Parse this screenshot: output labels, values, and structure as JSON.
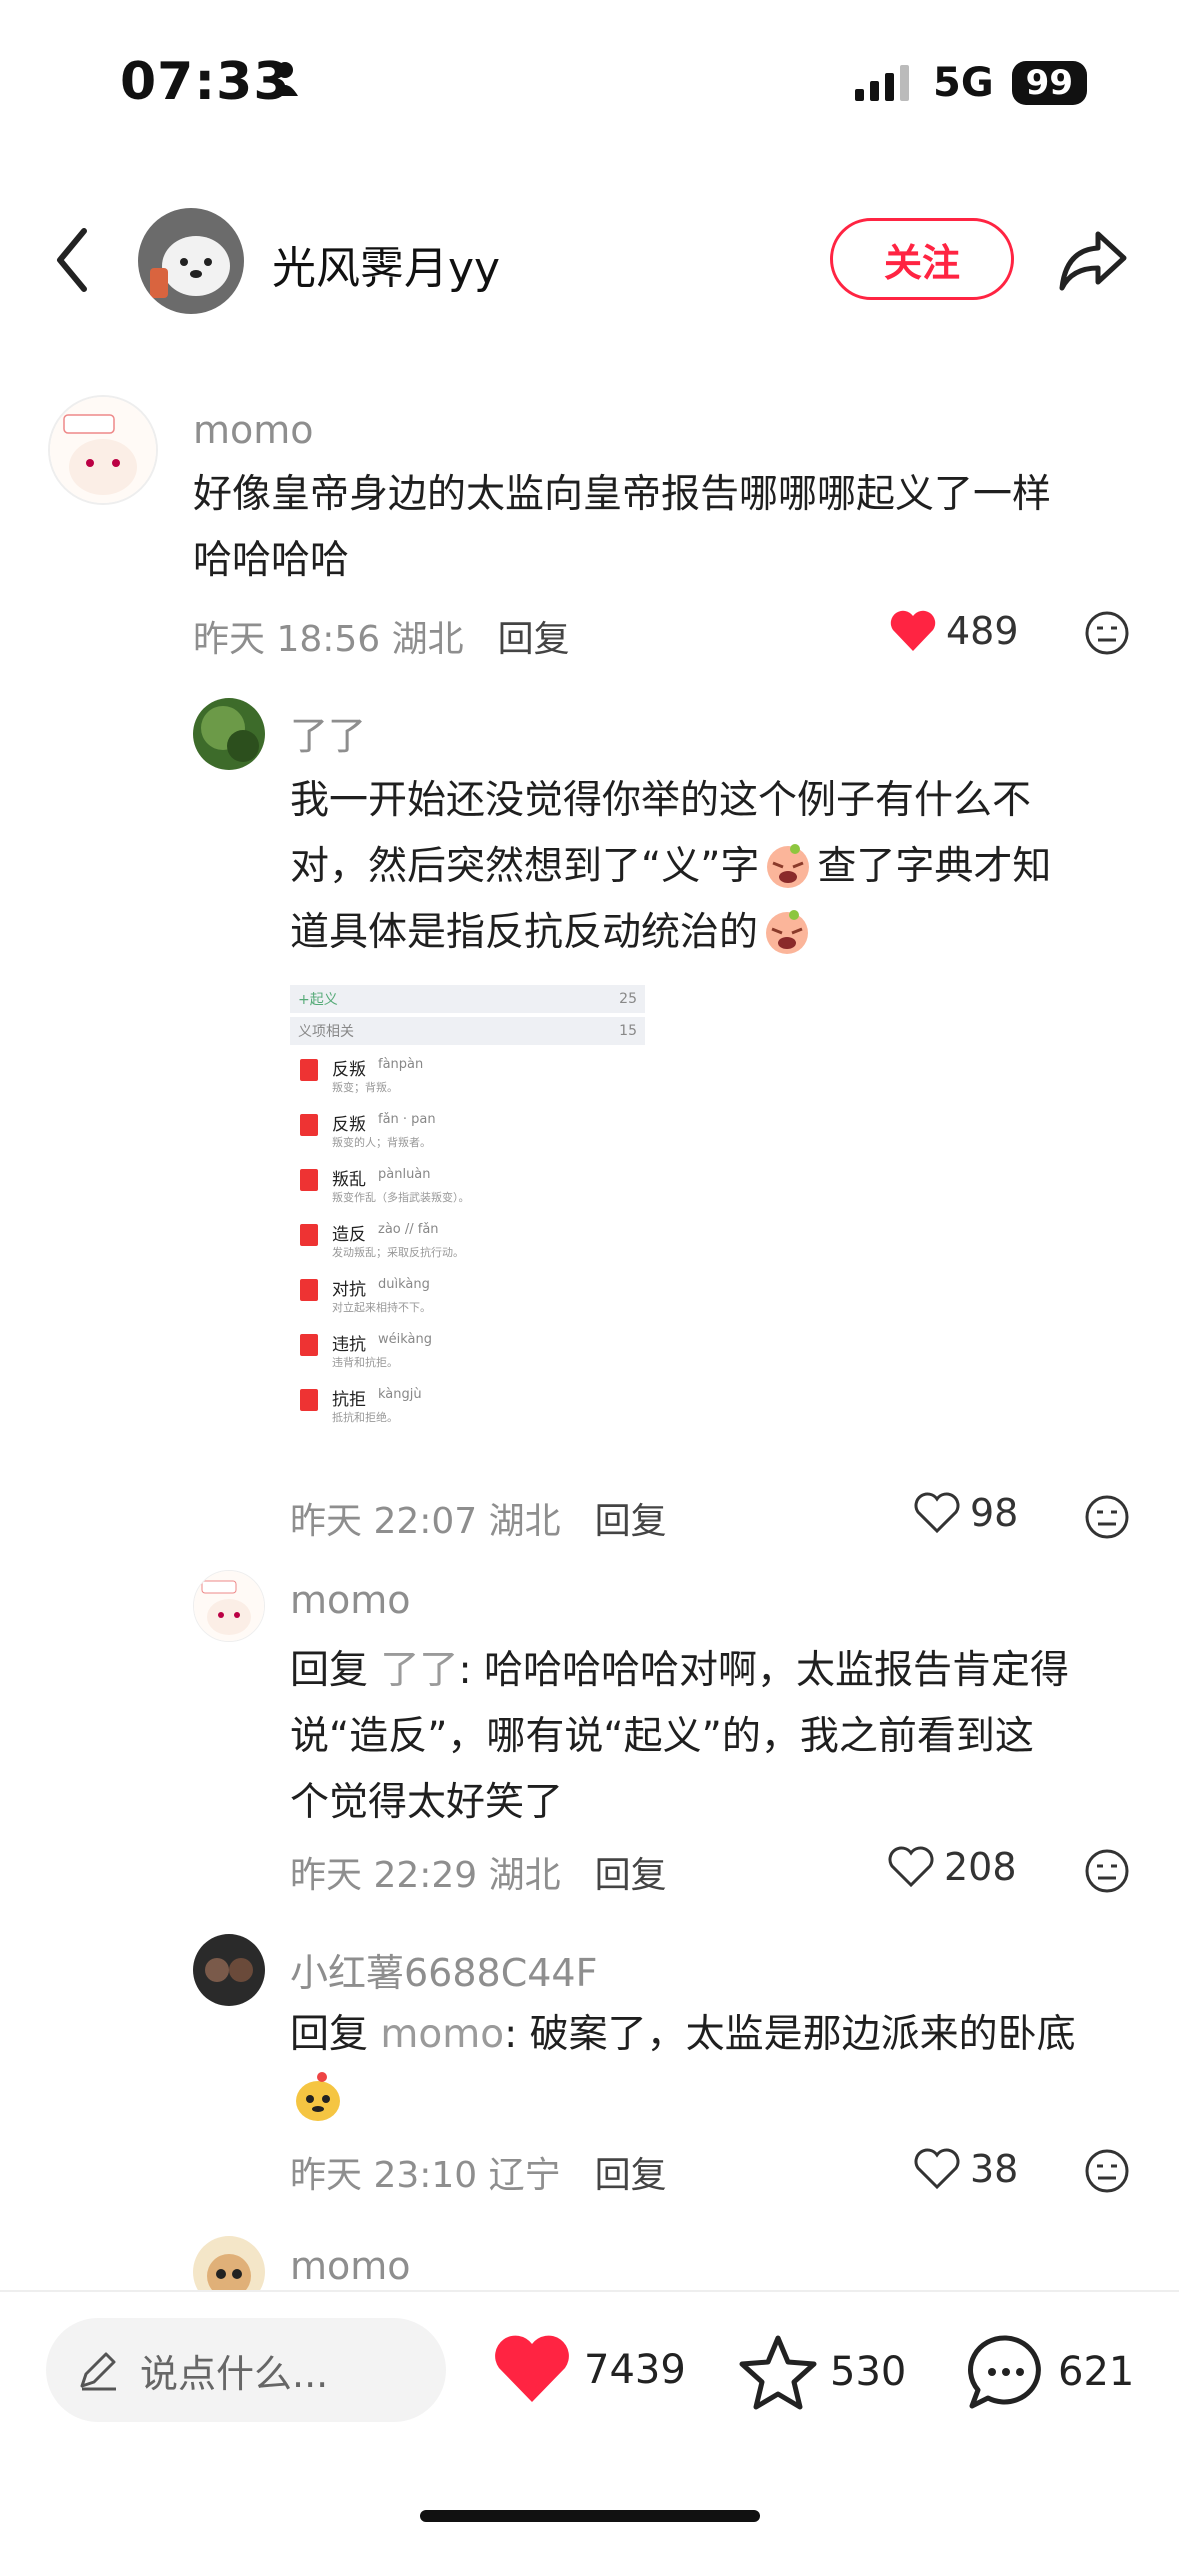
{
  "status_bar": {
    "time": "07:33",
    "network": "5G",
    "battery": "99"
  },
  "header": {
    "author_name": "光风霁月yy",
    "follow_label": "关注"
  },
  "comments": [
    {
      "user": "momo",
      "text": "好像皇帝身边的太监向皇帝报告哪哪哪起义了一样哈哈哈哈",
      "line1": "好像皇帝身边的太监向皇帝报告哪哪哪起义了一样",
      "line2": "哈哈哈哈",
      "time": "昨天 18:56 湖北",
      "reply_label": "回复",
      "likes": "489",
      "liked": true
    },
    {
      "user": "了了",
      "line1": "我一开始还没觉得你举的这个例子有什么不",
      "line2a": "对，然后突然想到了“义”字",
      "line2b": "查了字典才知",
      "line3": "道具体是指反抗反动统治的",
      "time": "昨天 22:07 湖北",
      "reply_label": "回复",
      "likes": "98",
      "liked": false,
      "dict_image": {
        "head_word": "+起义",
        "head_count": "25",
        "section": "义项相关",
        "section_count": "15",
        "entries": [
          {
            "word": "反叛",
            "pinyin": "fànpàn",
            "def": "叛变；背叛。"
          },
          {
            "word": "反叛",
            "pinyin": "fǎn · pan",
            "def": "叛变的人；背叛者。"
          },
          {
            "word": "叛乱",
            "pinyin": "pànluàn",
            "def": "叛变作乱（多指武装叛变）。"
          },
          {
            "word": "造反",
            "pinyin": "zào // fǎn",
            "def": "发动叛乱；采取反抗行动。"
          },
          {
            "word": "对抗",
            "pinyin": "duìkàng",
            "def": "对立起来相持不下。"
          },
          {
            "word": "违抗",
            "pinyin": "wéikàng",
            "def": "违背和抗拒。"
          },
          {
            "word": "抗拒",
            "pinyin": "kàngjù",
            "def": "抵抗和拒绝。"
          }
        ]
      }
    },
    {
      "user": "momo",
      "reply_prefix": "回复",
      "mention": "了了",
      "line1_rest": ": 哈哈哈哈哈对啊，太监报告肯定得",
      "line2": "说“造反”，哪有说“起义”的，我之前看到这",
      "line3": "个觉得太好笑了",
      "time": "昨天 22:29 湖北",
      "reply_label": "回复",
      "likes": "208",
      "liked": false
    },
    {
      "user": "小红薯6688C44F",
      "reply_prefix": "回复",
      "mention": "momo",
      "line1_rest": ": 破案了，太监是那边派来的卧底",
      "time": "昨天 23:10 辽宁",
      "reply_label": "回复",
      "likes": "38",
      "liked": false
    },
    {
      "user": "momo"
    }
  ],
  "bottom_bar": {
    "input_placeholder": "说点什么...",
    "likes": "7439",
    "stars": "530",
    "comments": "621"
  },
  "colors": {
    "accent": "#ff2442",
    "muted": "#8e8e8e"
  }
}
